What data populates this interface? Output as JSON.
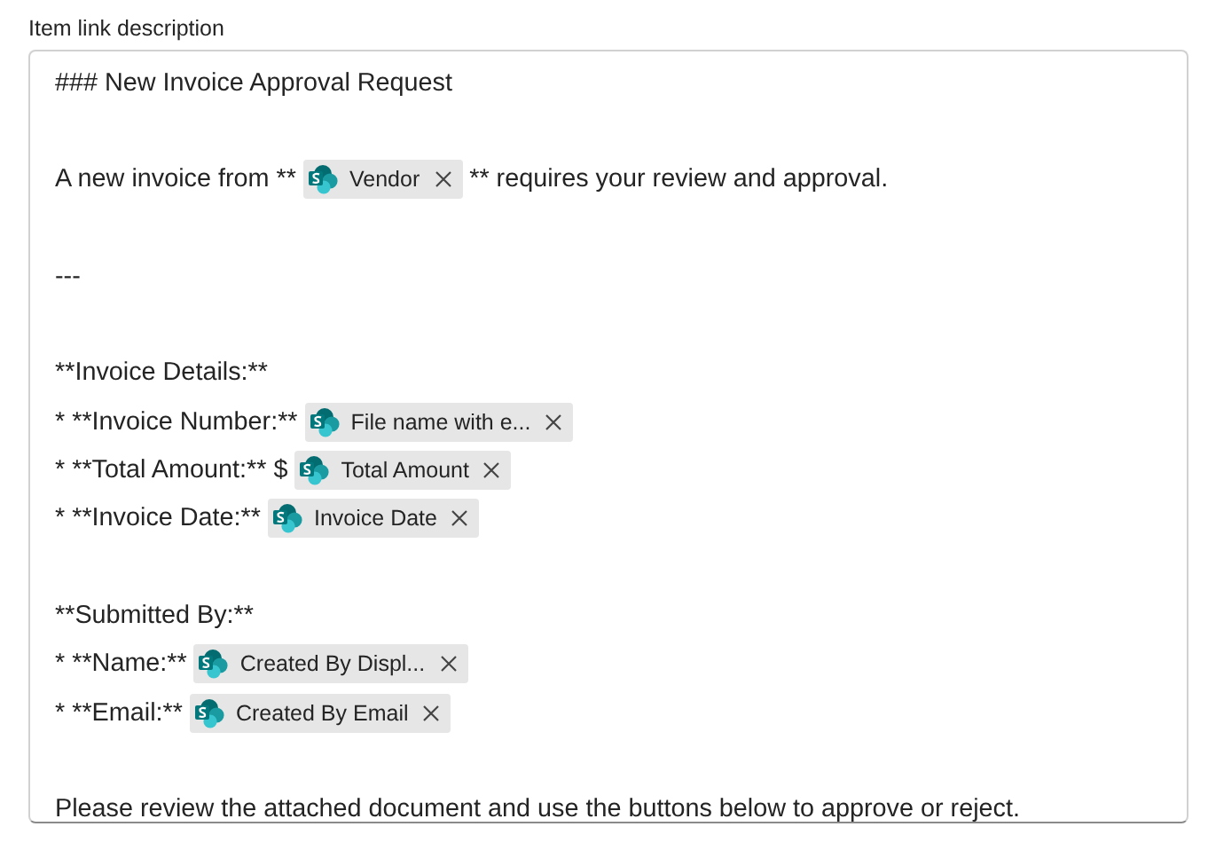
{
  "label": "Item link description",
  "editor": {
    "lines": [
      {
        "kind": "text",
        "segments": [
          {
            "kind": "text",
            "text": "### New Invoice Approval Request"
          }
        ]
      },
      {
        "kind": "blank"
      },
      {
        "kind": "text",
        "segments": [
          {
            "kind": "text",
            "text": "A new invoice from **"
          },
          {
            "kind": "token",
            "label": "Vendor"
          },
          {
            "kind": "text",
            "text": "** requires your review and approval."
          }
        ]
      },
      {
        "kind": "blank"
      },
      {
        "kind": "text",
        "segments": [
          {
            "kind": "text",
            "text": "---"
          }
        ]
      },
      {
        "kind": "blank"
      },
      {
        "kind": "text",
        "segments": [
          {
            "kind": "text",
            "text": "**Invoice Details:**"
          }
        ]
      },
      {
        "kind": "text",
        "segments": [
          {
            "kind": "text",
            "text": "* **Invoice Number:**"
          },
          {
            "kind": "token",
            "label": "File name with e..."
          }
        ]
      },
      {
        "kind": "text",
        "segments": [
          {
            "kind": "text",
            "text": "* **Total Amount:** $"
          },
          {
            "kind": "token",
            "label": "Total Amount"
          }
        ]
      },
      {
        "kind": "text",
        "segments": [
          {
            "kind": "text",
            "text": "* **Invoice Date:**"
          },
          {
            "kind": "token",
            "label": "Invoice Date"
          }
        ]
      },
      {
        "kind": "blank"
      },
      {
        "kind": "text",
        "segments": [
          {
            "kind": "text",
            "text": "**Submitted By:**"
          }
        ]
      },
      {
        "kind": "text",
        "segments": [
          {
            "kind": "text",
            "text": "* **Name:**"
          },
          {
            "kind": "token",
            "label": "Created By Displ..."
          }
        ]
      },
      {
        "kind": "text",
        "segments": [
          {
            "kind": "text",
            "text": "* **Email:**"
          },
          {
            "kind": "token",
            "label": "Created By Email"
          }
        ]
      },
      {
        "kind": "blank"
      },
      {
        "kind": "text",
        "segments": [
          {
            "kind": "text",
            "text": "Please review the attached document and use the buttons below to approve or reject."
          }
        ]
      }
    ]
  }
}
